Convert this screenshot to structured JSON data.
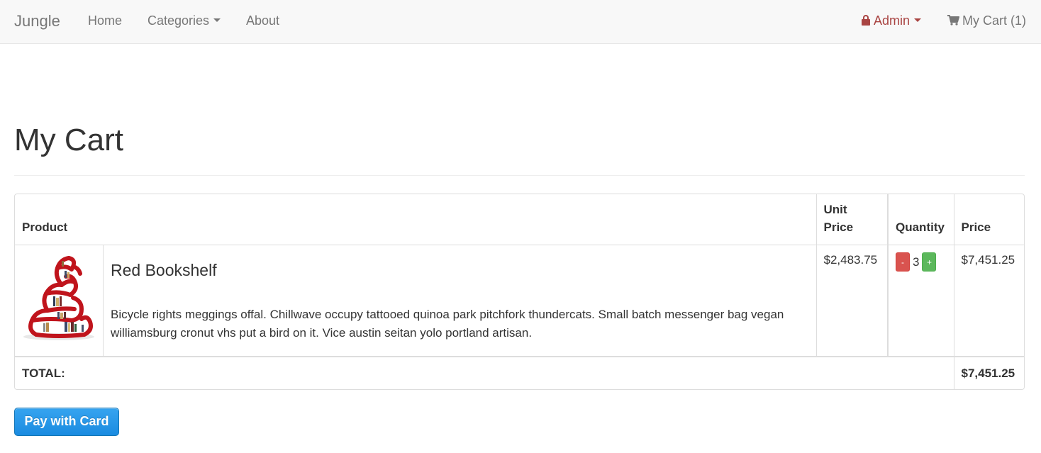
{
  "navbar": {
    "brand": "Jungle",
    "links": [
      "Home",
      "Categories",
      "About"
    ],
    "admin": "Admin",
    "cart": "My Cart (1)",
    "admin_color": "#a94442"
  },
  "page": {
    "title": "My Cart"
  },
  "cart_table": {
    "headers": {
      "product": "Product",
      "unit_price_line1": "Unit",
      "unit_price_line2": "Price",
      "quantity": "Quantity",
      "price": "Price"
    },
    "items": [
      {
        "name": "Red Bookshelf",
        "description": "Bicycle rights meggings offal. Chillwave occupy tattooed quinoa park pitchfork thundercats. Small batch messenger bag vegan williamsburg cronut vhs put a bird on it. Vice austin seitan yolo portland artisan.",
        "unit_price": "$2,483.75",
        "quantity": "3",
        "decrease_label": "-",
        "increase_label": "+",
        "price": "$7,451.25",
        "image_icon": "red-bookshelf-image"
      }
    ],
    "total_label": "TOTAL:",
    "total_value": "$7,451.25"
  },
  "actions": {
    "pay_label": "Pay with Card",
    "pay_color": "#1a8be0"
  }
}
